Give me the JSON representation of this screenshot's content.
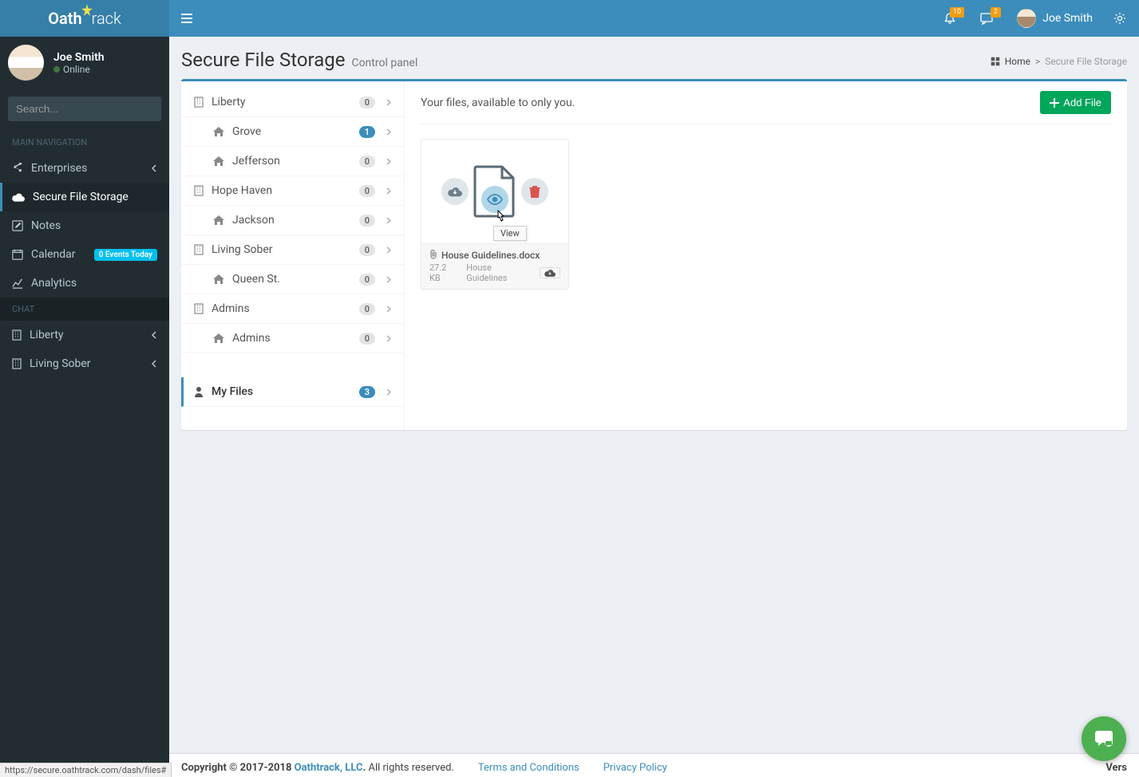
{
  "brand": {
    "part1": "Oath",
    "part2": "rack"
  },
  "topbar": {
    "notif_count": "10",
    "msg_count": "2",
    "username": "Joe Smith"
  },
  "sidebar": {
    "user": {
      "name": "Joe Smith",
      "status": "Online"
    },
    "search_placeholder": "Search...",
    "header1": "MAIN NAVIGATION",
    "nav": {
      "enterprises": "Enterprises",
      "secure_storage": "Secure File Storage",
      "notes": "Notes",
      "calendar": "Calendar",
      "calendar_badge": "0 Events Today",
      "analytics": "Analytics"
    },
    "header2": "Chat",
    "chat": {
      "liberty": "Liberty",
      "living_sober": "Living Sober"
    }
  },
  "page": {
    "title": "Secure File Storage",
    "subtitle": "Control panel",
    "breadcrumb_home": "Home",
    "breadcrumb_current": "Secure File Storage"
  },
  "tree": [
    {
      "label": "Liberty",
      "count": "0",
      "type": "building"
    },
    {
      "label": "Grove",
      "count": "1",
      "type": "house",
      "child": true,
      "blue": true
    },
    {
      "label": "Jefferson",
      "count": "0",
      "type": "house",
      "child": true
    },
    {
      "label": "Hope Haven",
      "count": "0",
      "type": "building"
    },
    {
      "label": "Jackson",
      "count": "0",
      "type": "house",
      "child": true
    },
    {
      "label": "Living Sober",
      "count": "0",
      "type": "building"
    },
    {
      "label": "Queen St.",
      "count": "0",
      "type": "house",
      "child": true
    },
    {
      "label": "Admins",
      "count": "0",
      "type": "building"
    },
    {
      "label": "Admins",
      "count": "0",
      "type": "house",
      "child": true
    }
  ],
  "my_files": {
    "label": "My Files",
    "count": "3"
  },
  "files": {
    "description": "Your files, available to only you.",
    "add_btn": "Add File",
    "tooltip": "View",
    "card": {
      "name": "House Guidelines.docx",
      "size": "27.2 KB",
      "tag": "House Guidelines"
    }
  },
  "footer": {
    "copyright_prefix": "Copyright © 2017-2018 ",
    "company": "Oathtrack, LLC",
    "rights": " All rights reserved.",
    "terms": "Terms and Conditions",
    "privacy": "Privacy Policy",
    "version_label": "Vers"
  },
  "status_url": "https://secure.oathtrack.com/dash/files#"
}
